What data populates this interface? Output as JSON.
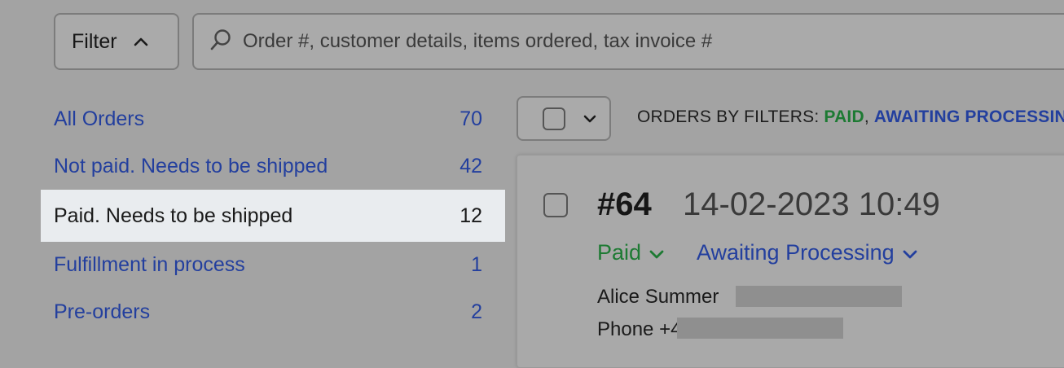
{
  "filter": {
    "label": "Filter"
  },
  "search": {
    "placeholder": "Order #, customer details, items ordered, tax invoice #"
  },
  "sidebar": {
    "items": [
      {
        "label": "All Orders",
        "count": "70"
      },
      {
        "label": "Not paid. Needs to be shipped",
        "count": "42"
      },
      {
        "label": "Paid. Needs to be shipped",
        "count": "12",
        "active": true
      },
      {
        "label": "Fulfillment in process",
        "count": "1"
      },
      {
        "label": "Pre-orders",
        "count": "2"
      }
    ]
  },
  "filters_line": {
    "prefix": "ORDERS BY FILTERS: ",
    "paid": "PAID",
    "sep1": ", ",
    "awaiting": "AWAITING PROCESSING",
    "sep2": ","
  },
  "order": {
    "number": "#64",
    "date": "14-02-2023 10:49",
    "payment_status": "Paid",
    "fulfillment_status": "Awaiting Processing",
    "customer_name": "Alice Summer",
    "phone_prefix": "Phone +4"
  },
  "colors": {
    "link_blue": "#233f9e",
    "paid_green": "#1d7a33",
    "active_row": "#e9ecef"
  }
}
